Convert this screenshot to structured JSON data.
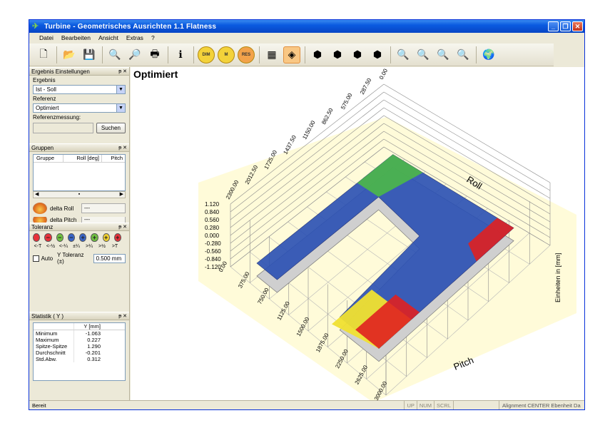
{
  "window": {
    "title": "Turbine - Geometrisches Ausrichten 1.1  Flatness"
  },
  "titlebar_buttons": {
    "minimize": "_",
    "maximize": "❐",
    "close": "✕"
  },
  "menu": [
    "Datei",
    "Bearbeiten",
    "Ansicht",
    "Extras",
    "?"
  ],
  "toolbar": {
    "tools": [
      {
        "name": "new-icon",
        "glyph": "🗋"
      },
      {
        "name": "open-icon",
        "glyph": "📂"
      },
      {
        "name": "save-icon",
        "glyph": "💾"
      },
      {
        "name": "print-preview-icon",
        "glyph": "🔍"
      },
      {
        "name": "page-preview-icon",
        "glyph": "🔎"
      },
      {
        "name": "printer-icon",
        "glyph": "🖶"
      },
      {
        "name": "info-icon",
        "glyph": "ℹ"
      },
      {
        "name": "dim-icon",
        "label": "DIM"
      },
      {
        "name": "m-icon",
        "label": "M"
      },
      {
        "name": "res-icon",
        "label": "RES"
      },
      {
        "name": "table-view-icon",
        "glyph": "▦"
      },
      {
        "name": "3d-view-icon",
        "glyph": "◈"
      },
      {
        "name": "view-front-icon",
        "glyph": "⬢"
      },
      {
        "name": "view-side-icon",
        "glyph": "⬢"
      },
      {
        "name": "view-top-icon",
        "glyph": "⬢"
      },
      {
        "name": "view-iso-icon",
        "glyph": "⬢"
      },
      {
        "name": "zoom-in-icon",
        "glyph": "🔍"
      },
      {
        "name": "zoom-out-icon",
        "glyph": "🔍"
      },
      {
        "name": "zoom-fit-icon",
        "glyph": "🔍"
      },
      {
        "name": "zoom-pan-icon",
        "glyph": "🔍"
      },
      {
        "name": "globe-icon",
        "glyph": "🌍"
      }
    ]
  },
  "panels": {
    "ergebnis": {
      "title": "Ergebnis Einstellungen",
      "header_controls": "ᵽ ✕",
      "ergebnis_label": "Ergebnis",
      "ergebnis_value": "Ist - Soll",
      "referenz_label": "Referenz",
      "referenz_value": "Optimiert",
      "referenzmessung_label": "Referenzmessung:",
      "search_button": "Suchen"
    },
    "gruppen": {
      "title": "Gruppen",
      "header_controls": "ᵽ ✕",
      "columns": [
        "Gruppe",
        "Roll [deg]",
        "Pitch"
      ],
      "delta_roll_label": "delta Roll",
      "delta_roll_value": "---",
      "delta_pitch_label": "delta Pitch",
      "delta_pitch_value": "---"
    },
    "toleranz": {
      "title": "Toleranz",
      "header_controls": "ᵽ ✕",
      "dots": [
        {
          "symbol": "",
          "color": "#e8323a"
        },
        {
          "symbol": "−",
          "color": "#e8323a"
        },
        {
          "symbol": "−",
          "color": "#6fc040"
        },
        {
          "symbol": "−",
          "color": "#3a66c8"
        },
        {
          "symbol": "+",
          "color": "#3a66c8"
        },
        {
          "symbol": "+",
          "color": "#6fc040"
        },
        {
          "symbol": "+",
          "color": "#f2d22e"
        },
        {
          "symbol": "+",
          "color": "#e8323a"
        }
      ],
      "labels": [
        "<-T",
        "<-½",
        "<-¼",
        "±¼",
        ">¼",
        ">½",
        ">T"
      ],
      "auto_label": "Auto",
      "y_tol_label": "Y Toleranz (±)",
      "y_tol_value": "0.500 mm"
    },
    "statistik": {
      "title": "Statistik ( Y )",
      "header_controls": "ᵽ ✕",
      "col_header": "Y [mm]",
      "rows": [
        {
          "k": "Minimum",
          "v": "-1.063"
        },
        {
          "k": "Maximum",
          "v": "0.227"
        },
        {
          "k": "Spitze-Spitze",
          "v": "1.290"
        },
        {
          "k": "Durchschnitt",
          "v": "-0.201"
        },
        {
          "k": "Std.Abw.",
          "v": "0.312"
        }
      ]
    }
  },
  "view": {
    "title": "Optimiert",
    "roll_label": "Roll",
    "pitch_label": "Pitch",
    "z_label": "Einheiten in [mm]",
    "roll_ticks": [
      "2300.00",
      "2012.50",
      "1725.00",
      "1437.50",
      "1150.00",
      "862.50",
      "575.00",
      "287.50",
      "0.00"
    ],
    "pitch_ticks": [
      "0.00",
      "375.00",
      "750.00",
      "1125.00",
      "1500.00",
      "1875.00",
      "2250.00",
      "2625.00",
      "3000.00"
    ],
    "z_ticks": [
      "1.120",
      "0.840",
      "0.560",
      "0.280",
      "0.000",
      "-0.280",
      "-0.560",
      "-0.840",
      "-1.120"
    ]
  },
  "status": {
    "ready": "Bereit",
    "cells": [
      "UP",
      "NUM",
      "SCRL"
    ],
    "doc": "Alignment CENTER Ebenheit Da"
  }
}
